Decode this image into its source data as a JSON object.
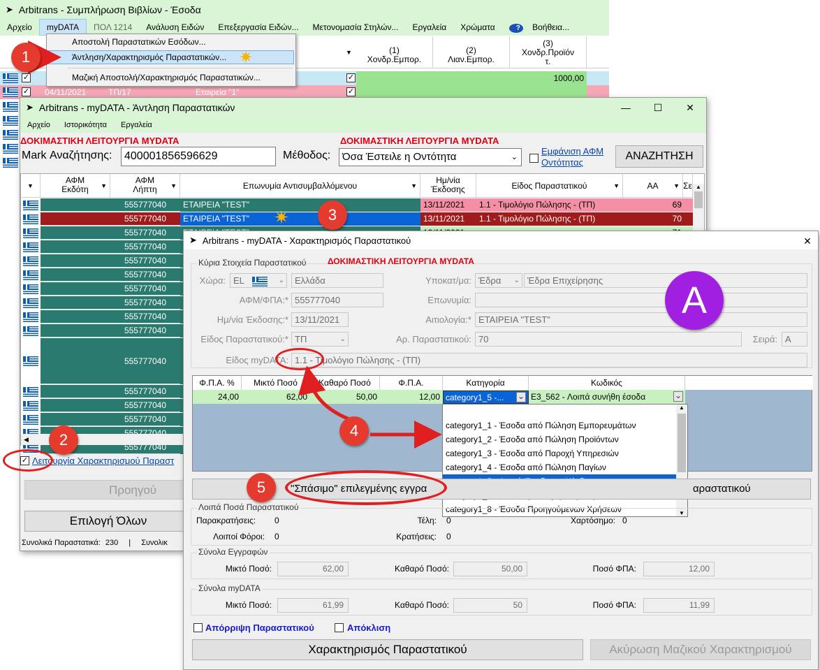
{
  "win1": {
    "title": "Arbitrans - Συμπλήρωση Βιβλίων - Έσοδα",
    "menu": [
      "Αρχείο",
      "myDATA",
      "ΠΟΛ 1214",
      "Ανάλυση Ειδών",
      "Επεξεργασία Ειδών...",
      "Μετονομασία Στηλών...",
      "Εργαλεία",
      "Χρώματα",
      "Βοήθεια..."
    ],
    "dropdown": [
      "Αποστολή Παραστατικών Εσόδων...",
      "Άντληση/Χαρακτηρισμός Παραστατικών...",
      "Μαζική Αποστολή/Χαρακτηρισμός Παραστατικών..."
    ],
    "cols": [
      "(1) Χονδρ.Εμπορ.",
      "(2) Λιαν.Εμπορ.",
      "(3) Χονδρ.Προϊόντ."
    ],
    "cols_short": [
      "(1)",
      "Χονδρ.Εμπορ.",
      "(2)",
      "Λιαν.Εμπορ.",
      "(3)",
      "Χονδρ.Προϊόν",
      "τ."
    ],
    "row_value": "1000,00",
    "row2_date": "04/11/2021",
    "row2_num": "ΤΠ/17",
    "row2_name": "Εταιρεία \"1\""
  },
  "win2": {
    "title": "Arbitrans - myDATA - Άντληση Παραστατικών",
    "menu": [
      "Αρχείο",
      "Ιστορικότητα",
      "Εργαλεία"
    ],
    "test_mode": "ΔΟΚΙΜΑΣΤΙΚΗ ΛΕΙΤΟΥΡΓΙΑ MYDATA",
    "mark_label": "Mark Αναζήτησης:",
    "mark_value": "400001856596629",
    "method_label": "Μέθοδος:",
    "method_value": "Όσα Έστειλε η Οντότητα",
    "show_afm_line1": "Εμφάνιση ΑΦΜ",
    "show_afm_line2": "Οντότητας",
    "search_button": "ΑΝΑΖΗΤΗΣΗ",
    "headers": {
      "afm_issuer_1": "ΑΦΜ",
      "afm_issuer_2": "Εκδότη",
      "afm_receiver_1": "ΑΦΜ",
      "afm_receiver_2": "Λήπτη",
      "counterparty": "Επωνυμία Αντισυμβαλλόμενου",
      "date_1": "Ημ/νία",
      "date_2": "Έκδοσης",
      "type": "Είδος Παραστατικού",
      "aa": "ΑΑ",
      "extra": "Σε"
    },
    "rows": [
      {
        "afm": "555777040",
        "name": "ΕΤΑΙΡΕΙΑ \"TEST\"",
        "date": "13/11/2021",
        "type": "1.1 - Τιμολόγιο Πώλησης - (ΤΠ)",
        "aa": "69"
      },
      {
        "afm": "555777040",
        "name": "ΕΤΑΙΡΕΙΑ \"TEST\"",
        "date": "13/11/2021",
        "type": "1.1 - Τιμολόγιο Πώλησης - (ΤΠ)",
        "aa": "70"
      },
      {
        "afm": "555777040",
        "name": "ΕΤΑΙΡΕΙΑ \"TEST\"",
        "date": "13/11/2021",
        "type": "",
        "aa": "71"
      },
      {
        "afm": "555777040"
      },
      {
        "afm": "555777040"
      },
      {
        "afm": "555777040"
      },
      {
        "afm": "555777040"
      },
      {
        "afm": "555777040"
      },
      {
        "afm": "555777040"
      },
      {
        "afm": "555777040"
      },
      {
        "afm": "555777040"
      },
      {
        "afm": "555777040"
      },
      {
        "afm": "555777040"
      },
      {
        "afm": "555777040"
      },
      {
        "afm": "555777040"
      },
      {
        "afm": "555777040"
      }
    ],
    "mode_checkbox": "Λειτουργία Χαρακτηρισμού Παραστ",
    "prev_button": "Προηγού",
    "select_all": "Επιλογή Όλων",
    "totals_1": "Συνολικά Παραστατικά:",
    "totals_value": "230",
    "totals_sep": "|",
    "totals_2": "Συνολικ"
  },
  "win3": {
    "title": "Arbitrans - myDATA - Χαρακτηρισμός Παραστατικού",
    "section_main": "Κύρια Στοιχεία Παραστατικού",
    "test_mode": "ΔΟΚΙΜΑΣΤΙΚΗ ΛΕΙΤΟΥΡΓΙΑ MYDATA",
    "country_label": "Χώρα:",
    "country_code": "EL",
    "country_name": "Ελλάδα",
    "branch_label": "Υποκατ/μα:",
    "branch_value": "Έδρα",
    "branch_name": "Έδρα Επιχείρησης",
    "afm_label": "ΑΦΜ/ΦΠΑ:*",
    "afm_value": "555777040",
    "name_label": "Επωνυμία:",
    "date_label": "Ημ/νία Έκδοσης:*",
    "date_value": "13/11/2021",
    "reason_label": "Αιτιολογία:*",
    "reason_value": "ΕΤΑΙΡΕΙΑ \"TEST\"",
    "doc_type_label": "Είδος Παραστατικού:*",
    "doc_type_value": "ΤΠ",
    "doc_num_label": "Αρ. Παραστατικού:",
    "doc_num_value": "70",
    "series_label": "Σειρά:",
    "series_value": "A",
    "mydata_type_label": "Είδος myDATA:",
    "mydata_type_value": "1.1 - Τιμολόγιο Πώλησης - (ΤΠ)",
    "grid_headers": [
      "Φ.Π.Α. %",
      "Μικτό Ποσό",
      "Καθαρό Ποσό",
      "Φ.Π.Α.",
      "Κατηγορία",
      "Κωδικός"
    ],
    "grid_row": [
      "24,00",
      "62,00",
      "50,00",
      "12,00",
      "category1_5  -...",
      "E3_562 - Λοιπά συνήθη έσοδα"
    ],
    "category_options": [
      "category1_1 - Έσοδα από Πώληση Εμπορευμάτων",
      "category1_2 - Έσοδα από Πώληση Προϊόντων",
      "category1_3 - Έσοδα από Παροχή Υπηρεσιών",
      "category1_4 - Έσοδα από Πώληση Παγίων",
      "category1_5 - Λοιπά Έσοδα και Κέρδη",
      "category1_7 - Έσοδα για Λογαριασμό Τρίτων",
      "category1_8 - Έσοδα Προηγούμενων Χρήσεων"
    ],
    "split_button": "\"Σπάσιμο\" επιλεγμένης εγγρα",
    "split_button_right": "αραστατικού",
    "section_other": "Λοιπά Ποσά Παραστατικού",
    "withholdings_label": "Παρακρατήσεις:",
    "withholdings_value": "0",
    "fees_label": "Τέλη:",
    "fees_value": "0",
    "stamp_label": "Χαρτόσημο:",
    "stamp_value": "0",
    "other_taxes_label": "Λοιποί Φόροι:",
    "other_taxes_value": "0",
    "deductions_label": "Κρατήσεις:",
    "deductions_value": "0",
    "section_entries": "Σύνολα Εγγραφών",
    "gross_label": "Μικτό Ποσό:",
    "net_label": "Καθαρό Ποσό:",
    "vat_label": "Ποσό ΦΠΑ:",
    "entries_gross": "62,00",
    "entries_net": "50,00",
    "entries_vat": "12,00",
    "section_mydata": "Σύνολα myDATA",
    "mydata_gross": "61,99",
    "mydata_net": "50",
    "mydata_vat": "11,99",
    "reject_label": "Απόρριψη Παραστατικού",
    "deviation_label": "Απόκλιση",
    "characterize_button": "Χαρακτηρισμός Παραστατικού",
    "cancel_bulk_button": "Ακύρωση Μαζικού Χαρακτηρισμού"
  },
  "badges": [
    "1",
    "2",
    "3",
    "4",
    "5",
    "A"
  ],
  "colors": {
    "teal": "#2b7a6f",
    "pink_row": "#f48fa6",
    "dark_red_row": "#a01c1c",
    "green_row": "#c8f0c0",
    "selection_blue": "#0a64d6",
    "grid_blue": "#9fb8d0",
    "badge_red": "#e53b2f",
    "badge_purple": "#a01fe0",
    "title_green": "#d9f5d5"
  }
}
